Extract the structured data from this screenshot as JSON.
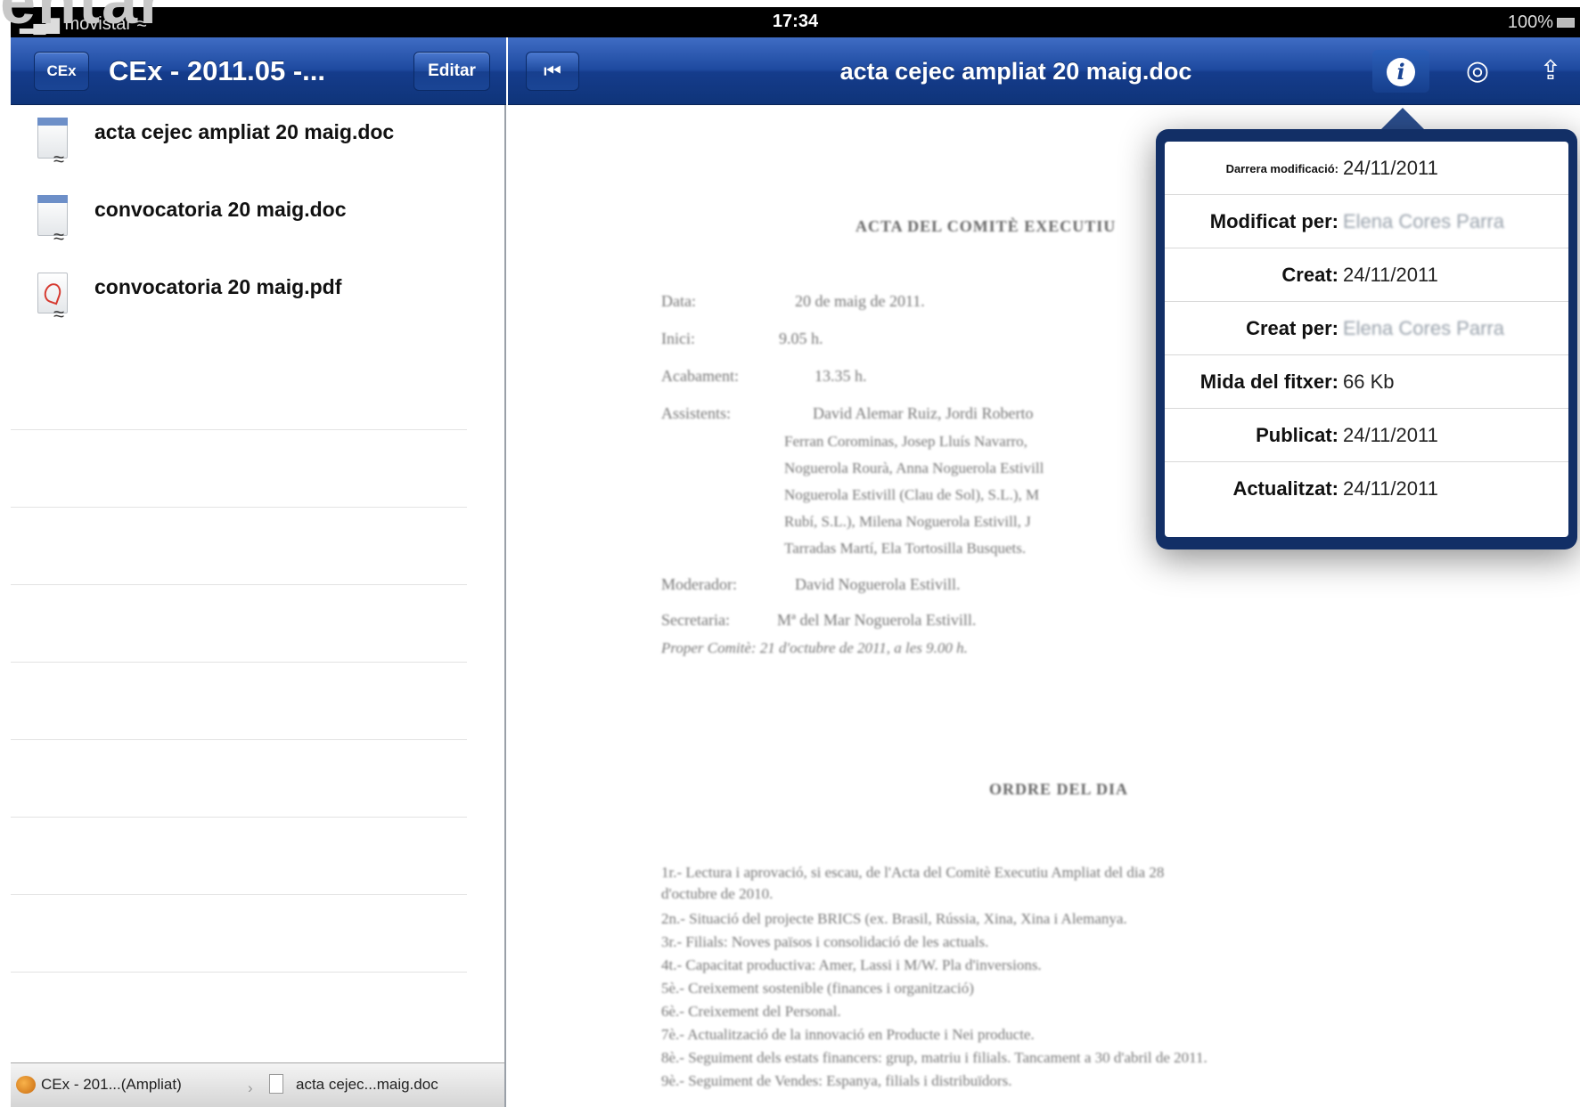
{
  "status_bar": {
    "carrier": "movistar",
    "time": "17:34",
    "battery": "100%",
    "cropped_overlay_text": "entar"
  },
  "left_pane": {
    "back_label": "CEx",
    "title": "CEx - 2011.05 -...",
    "edit_label": "Editar",
    "files": [
      {
        "name": "acta cejec ampliat 20 maig.doc",
        "type": "doc"
      },
      {
        "name": "convocatoria 20 maig.doc",
        "type": "doc"
      },
      {
        "name": "convocatoria 20 maig.pdf",
        "type": "pdf"
      }
    ],
    "tabs": [
      {
        "label": "CEx - 201...(Ampliat)"
      },
      {
        "label": "acta cejec...maig.doc"
      }
    ]
  },
  "right_pane": {
    "doc_title": "acta cejec ampliat 20 maig.doc",
    "icons": {
      "info": "info-icon",
      "target": "target-icon",
      "share": "share-icon"
    }
  },
  "document": {
    "heading": "ACTA DEL COMITÈ EXECUTIU",
    "fields": [
      {
        "label": "Data:",
        "value": "20 de maig de 2011."
      },
      {
        "label": "Inici:",
        "value": "9.05 h."
      },
      {
        "label": "Acabament:",
        "value": "13.35 h."
      },
      {
        "label": "Assistents:",
        "value": "David Alemar Ruiz, Jordi Roberto"
      }
    ],
    "attendee_lines": [
      "Ferran Corominas, Josep Lluís Navarro,",
      "Noguerola Rourà, Anna Noguerola Estivill",
      "Noguerola Estivill (Clau de Sol), S.L.), M",
      "Rubí, S.L.), Milena Noguerola Estivill, J",
      "Tarradas Martí, Ela Tortosilla Busquets."
    ],
    "moderador": {
      "label": "Moderador:",
      "value": "David Noguerola Estivill."
    },
    "secretaria": {
      "label": "Secretaria:",
      "value": "Mª del Mar Noguerola Estivill."
    },
    "next_meeting": "Proper Comitè: 21 d'octubre de 2011, a les 9.00 h.",
    "subheading": "ORDRE DEL DIA",
    "agenda": [
      "1r.-    Lectura i aprovació, si escau, de l'Acta del Comitè Executiu Ampliat del dia 28",
      "         d'octubre de 2010.",
      "2n.- Situació del projecte BRICS (ex. Brasil, Rússia, Xina, Xina i Alemanya.",
      "3r.- Filials: Noves països i consolidació de les actuals.",
      "4t.- Capacitat productiva: Amer, Lassi i M/W. Pla d'inversions.",
      "5è.- Creixement sostenible (finances i organització)",
      "6è.- Creixement del Personal.",
      "7è.- Actualització de la innovació en Producte i Nei producte.",
      "8è.- Seguiment dels estats financers: grup, matriu i filials. Tancament a 30 d'abril de 2011.",
      "9è.- Seguiment de Vendes: Espanya, filials i distribuïdors."
    ]
  },
  "popover": {
    "rows": [
      {
        "label": "Darrera modificació:",
        "value": "24/11/2011",
        "blur": false,
        "small": true
      },
      {
        "label": "Modificat per:",
        "value": "Elena Cores Parra",
        "blur": true,
        "small": false
      },
      {
        "label": "Creat:",
        "value": "24/11/2011",
        "blur": false,
        "small": false
      },
      {
        "label": "Creat per:",
        "value": "Elena Cores Parra",
        "blur": true,
        "small": false
      },
      {
        "label": "Mida del fitxer:",
        "value": "66 Kb",
        "blur": false,
        "small": false
      },
      {
        "label": "Publicat:",
        "value": "24/11/2011",
        "blur": false,
        "small": false
      },
      {
        "label": "Actualitzat:",
        "value": "24/11/2011",
        "blur": false,
        "small": false
      }
    ]
  },
  "colors": {
    "navbar": "#1e4aa0",
    "popover_frame": "#122f66",
    "status_bar": "#000000"
  }
}
